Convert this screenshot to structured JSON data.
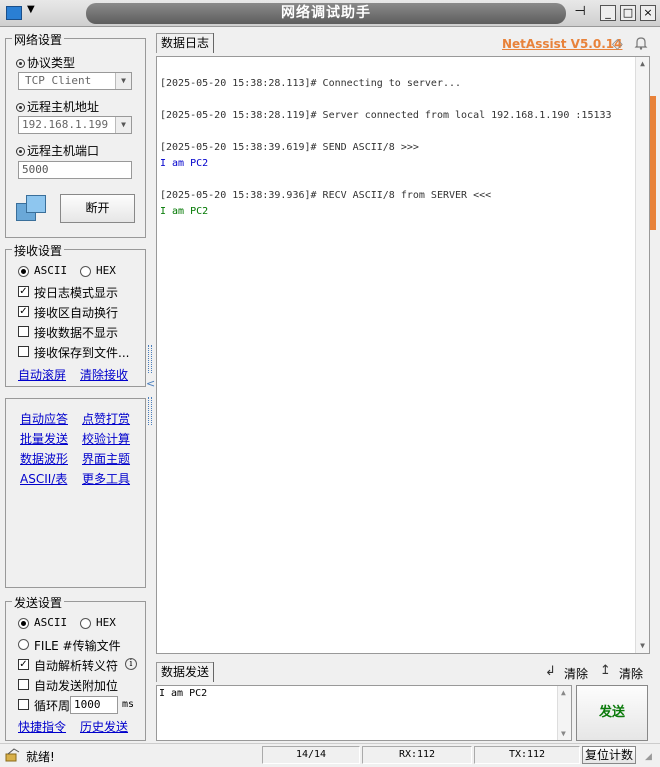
{
  "window": {
    "title": "网络调试助手",
    "pin_icon": "pin-icon",
    "minimize": "_",
    "maximize": "□",
    "close": "×"
  },
  "network": {
    "group_title": "网络设置",
    "protocol_label": "协议类型",
    "protocol_value": "TCP Client",
    "host_label": "远程主机地址",
    "host_value": "192.168.1.199",
    "port_label": "远程主机端口",
    "port_value": "5000",
    "disconnect_label": "断开"
  },
  "receive": {
    "group_title": "接收设置",
    "ascii_label": "ASCII",
    "hex_label": "HEX",
    "log_mode_label": "按日志模式显示",
    "auto_wrap_label": "接收区自动换行",
    "hide_data_label": "接收数据不显示",
    "save_file_label": "接收保存到文件...",
    "auto_scroll_link": "自动滚屏",
    "clear_recv_link": "清除接收"
  },
  "tools": {
    "auto_reply": "自动应答",
    "dot_matrix": "点赞打赏",
    "batch_send": "批量发送",
    "checksum": "校验计算",
    "waveform": "数据波形",
    "theme": "界面主题",
    "ascii_table": "ASCII/表",
    "more_tools": "更多工具"
  },
  "send": {
    "group_title": "发送设置",
    "ascii_label": "ASCII",
    "hex_label": "HEX",
    "file_label": "FILE #传输文件",
    "escape_label": "自动解析转义符",
    "append_label": "自动发送附加位",
    "cycle_label": "循环周期",
    "cycle_value": "1000",
    "cycle_unit": "ms",
    "shortcut_link": "快捷指令",
    "history_link": "历史发送"
  },
  "log": {
    "tab_label": "数据日志",
    "brand": "NetAssist V5.0.14",
    "lines": [
      {
        "text": "[2025-05-20 15:38:28.113]# Connecting to server...",
        "color": "#333333"
      },
      {
        "text": "[2025-05-20 15:38:28.119]# Server connected from local 192.168.1.190 :15133",
        "color": "#333333"
      },
      {
        "text": "[2025-05-20 15:38:39.619]# SEND ASCII/8 >>>",
        "color": "#333333"
      },
      {
        "text": "I am PC2",
        "color": "#0000cc"
      },
      {
        "text": "[2025-05-20 15:38:39.936]# RECV ASCII/8 from SERVER <<<",
        "color": "#333333"
      },
      {
        "text": "I am PC2",
        "color": "#007700"
      }
    ]
  },
  "sendarea": {
    "tab_label": "数据发送",
    "clear1": "清除",
    "clear2": "清除",
    "text": "I am PC2",
    "send_button": "发送"
  },
  "status": {
    "ready": "就绪!",
    "count": "14/14",
    "rx": "RX:112",
    "tx": "TX:112",
    "reset": "复位计数"
  },
  "colors": {
    "accent_orange": "#e8823a",
    "send_green": "#0a7a0a",
    "link_blue": "#0000cc"
  }
}
